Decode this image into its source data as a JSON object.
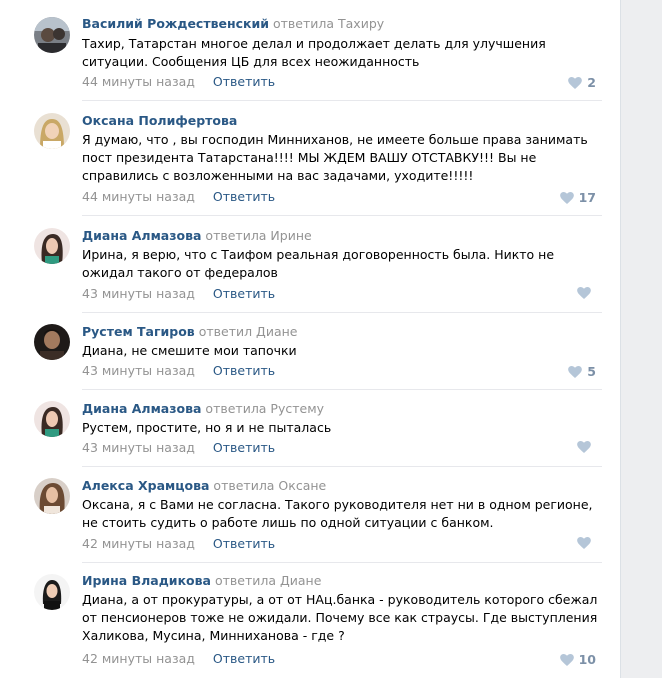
{
  "comments": [
    {
      "author": "Василий Рождественский",
      "reply_to": "ответила Тахиру",
      "text": "Тахир, Татарстан многое делал и продолжает делать для улучшения ситуации. Сообщения ЦБ для всех неожиданность",
      "time": "44 минуты назад",
      "reply_label": "Ответить",
      "likes": "2"
    },
    {
      "author": "Оксана Полифертова",
      "reply_to": "",
      "text": "Я думаю, что , вы господин Минниханов, не имеете больше права занимать пост президента Татарстана!!!! МЫ ЖДЕМ ВАШУ ОТСТАВКУ!!! Вы не справились с возложенными на вас задачами, уходите!!!!!",
      "time": "44 минуты назад",
      "reply_label": "Ответить",
      "likes": "17"
    },
    {
      "author": "Диана Алмазова",
      "reply_to": "ответила Ирине",
      "text": "Ирина, я верю, что с Таифом реальная договоренность была. Никто не ожидал такого от федералов",
      "time": "43 минуты назад",
      "reply_label": "Ответить",
      "likes": ""
    },
    {
      "author": "Рустем Тагиров",
      "reply_to": "ответил Диане",
      "text": "Диана, не смешите мои тапочки",
      "time": "43 минуты назад",
      "reply_label": "Ответить",
      "likes": "5"
    },
    {
      "author": "Диана Алмазова",
      "reply_to": "ответила Рустему",
      "text": "Рустем, простите, но я и не пыталась",
      "time": "43 минуты назад",
      "reply_label": "Ответить",
      "likes": ""
    },
    {
      "author": "Алекса Храмцова",
      "reply_to": "ответила Оксане",
      "text": "Оксана, я с Вами не согласна. Такого руководителя нет ни в одном регионе, не стоить судить о работе лишь по одной ситуации с банком.",
      "time": "42 минуты назад",
      "reply_label": "Ответить",
      "likes": ""
    },
    {
      "author": "Ирина Владикова",
      "reply_to": "ответила Диане",
      "text": "Диана, а от прокуратуры, а от от НАц.банка - руководитель которого сбежал от пенсионеров тоже не ожидали. Почему все как страусы. Где выступления Халикова, Мусина, Минниханова - где ?",
      "time": "42 минуты назад",
      "reply_label": "Ответить",
      "likes": "10"
    }
  ],
  "colors": {
    "link": "#2a5885",
    "muted": "#939393",
    "like": "#7c90a7",
    "like_icon": "#b5c6d8"
  },
  "icons": {
    "like": "heart-icon"
  }
}
